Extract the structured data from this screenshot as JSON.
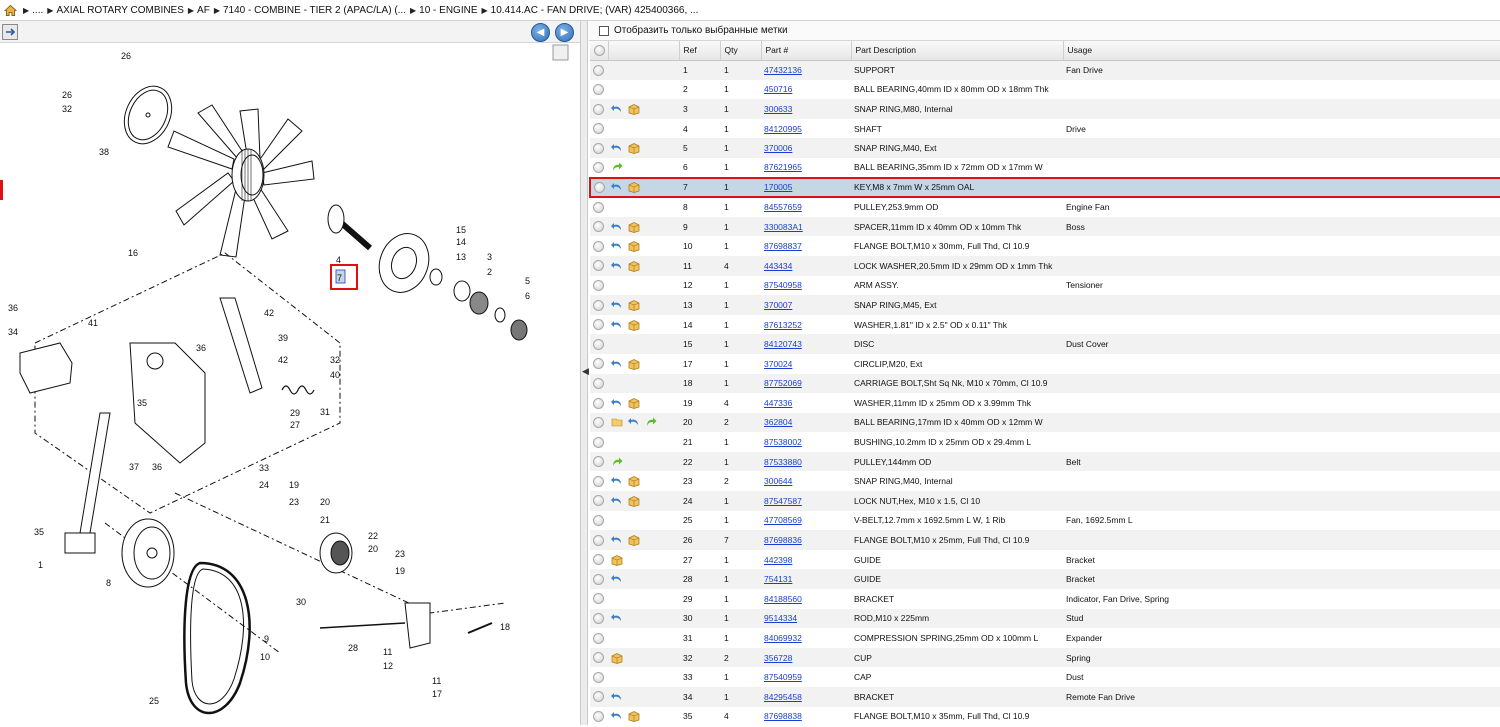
{
  "breadcrumb": {
    "items": [
      {
        "label": "...."
      },
      {
        "label": "AXIAL ROTARY COMBINES"
      },
      {
        "label": "AF"
      },
      {
        "label": "7140 - COMBINE - TIER 2 (APAC/LA) (..."
      },
      {
        "label": "10 - ENGINE"
      },
      {
        "label": "10.414.AC - FAN DRIVE; (VAR) 425400366, ..."
      }
    ]
  },
  "filter": {
    "label": "Отобразить только выбранные метки"
  },
  "table": {
    "headers": [
      "",
      "",
      "Ref",
      "Qty",
      "Part #",
      "Part Description",
      "Usage"
    ],
    "rows": [
      {
        "ref": "1",
        "qty": "1",
        "part": "47432136",
        "desc": "SUPPORT",
        "usage": "Fan Drive",
        "icons": []
      },
      {
        "ref": "2",
        "qty": "1",
        "part": "450716",
        "desc": "BALL BEARING,40mm ID x 80mm OD x 18mm Thk",
        "usage": "",
        "icons": []
      },
      {
        "ref": "3",
        "qty": "1",
        "part": "300633",
        "desc": "SNAP RING,M80, Internal",
        "usage": "",
        "icons": [
          "return-icon",
          "box-icon"
        ]
      },
      {
        "ref": "4",
        "qty": "1",
        "part": "84120995",
        "desc": "SHAFT",
        "usage": "Drive",
        "icons": []
      },
      {
        "ref": "5",
        "qty": "1",
        "part": "370006",
        "desc": "SNAP RING,M40, Ext",
        "usage": "",
        "icons": [
          "return-icon",
          "box-icon"
        ]
      },
      {
        "ref": "6",
        "qty": "1",
        "part": "87621965",
        "desc": "BALL BEARING,35mm ID x 72mm OD x 17mm W",
        "usage": "",
        "icons": [
          "forward-icon"
        ]
      },
      {
        "ref": "7",
        "qty": "1",
        "part": "170005",
        "desc": "KEY,M8 x 7mm W x 25mm OAL",
        "usage": "",
        "icons": [
          "return-icon",
          "box-icon"
        ],
        "selected": true
      },
      {
        "ref": "8",
        "qty": "1",
        "part": "84557659",
        "desc": "PULLEY,253.9mm OD",
        "usage": "Engine Fan",
        "icons": []
      },
      {
        "ref": "9",
        "qty": "1",
        "part": "330083A1",
        "desc": "SPACER,11mm ID x 40mm OD x 10mm Thk",
        "usage": "Boss",
        "icons": [
          "return-icon",
          "box-icon"
        ]
      },
      {
        "ref": "10",
        "qty": "1",
        "part": "87698837",
        "desc": "FLANGE BOLT,M10 x 30mm, Full Thd, Cl 10.9",
        "usage": "",
        "icons": [
          "return-icon",
          "box-icon"
        ]
      },
      {
        "ref": "11",
        "qty": "4",
        "part": "443434",
        "desc": "LOCK WASHER,20.5mm ID x 29mm OD x 1mm Thk",
        "usage": "",
        "icons": [
          "return-icon",
          "box-icon"
        ]
      },
      {
        "ref": "12",
        "qty": "1",
        "part": "87540958",
        "desc": "ARM ASSY.",
        "usage": "Tensioner",
        "icons": []
      },
      {
        "ref": "13",
        "qty": "1",
        "part": "370007",
        "desc": "SNAP RING,M45, Ext",
        "usage": "",
        "icons": [
          "return-icon",
          "box-icon"
        ]
      },
      {
        "ref": "14",
        "qty": "1",
        "part": "87613252",
        "desc": "WASHER,1.81\" ID x 2.5\" OD x 0.11\" Thk",
        "usage": "",
        "icons": [
          "return-icon",
          "box-icon"
        ]
      },
      {
        "ref": "15",
        "qty": "1",
        "part": "84120743",
        "desc": "DISC",
        "usage": "Dust Cover",
        "icons": []
      },
      {
        "ref": "17",
        "qty": "1",
        "part": "370024",
        "desc": "CIRCLIP,M20, Ext",
        "usage": "",
        "icons": [
          "return-icon",
          "box-icon"
        ]
      },
      {
        "ref": "18",
        "qty": "1",
        "part": "87752069",
        "desc": "CARRIAGE BOLT,Sht Sq Nk, M10 x 70mm, Cl 10.9",
        "usage": "",
        "icons": []
      },
      {
        "ref": "19",
        "qty": "4",
        "part": "447336",
        "desc": "WASHER,11mm ID x 25mm OD x 3.99mm Thk",
        "usage": "",
        "icons": [
          "return-icon",
          "box-icon"
        ]
      },
      {
        "ref": "20",
        "qty": "2",
        "part": "362804",
        "desc": "BALL BEARING,17mm ID x 40mm OD x 12mm W",
        "usage": "",
        "icons": [
          "folder-icon",
          "return-icon",
          "forward-icon"
        ]
      },
      {
        "ref": "21",
        "qty": "1",
        "part": "87538002",
        "desc": "BUSHING,10.2mm ID x 25mm OD x 29.4mm L",
        "usage": "",
        "icons": []
      },
      {
        "ref": "22",
        "qty": "1",
        "part": "87533880",
        "desc": "PULLEY,144mm OD",
        "usage": "Belt",
        "icons": [
          "forward-icon"
        ]
      },
      {
        "ref": "23",
        "qty": "2",
        "part": "300644",
        "desc": "SNAP RING,M40, Internal",
        "usage": "",
        "icons": [
          "return-icon",
          "box-icon"
        ]
      },
      {
        "ref": "24",
        "qty": "1",
        "part": "87547587",
        "desc": "LOCK NUT,Hex, M10 x 1.5, Cl 10",
        "usage": "",
        "icons": [
          "return-icon",
          "box-icon"
        ]
      },
      {
        "ref": "25",
        "qty": "1",
        "part": "47708569",
        "desc": "V-BELT,12.7mm x 1692.5mm L W, 1 Rib",
        "usage": "Fan, 1692.5mm L",
        "icons": []
      },
      {
        "ref": "26",
        "qty": "7",
        "part": "87698836",
        "desc": "FLANGE BOLT,M10 x 25mm, Full Thd, Cl 10.9",
        "usage": "",
        "icons": [
          "return-icon",
          "box-icon"
        ]
      },
      {
        "ref": "27",
        "qty": "1",
        "part": "442398",
        "desc": "GUIDE",
        "usage": "Bracket",
        "icons": [
          "box-icon"
        ]
      },
      {
        "ref": "28",
        "qty": "1",
        "part": "754131",
        "desc": "GUIDE",
        "usage": "Bracket",
        "icons": [
          "return-icon"
        ]
      },
      {
        "ref": "29",
        "qty": "1",
        "part": "84188560",
        "desc": "BRACKET",
        "usage": "Indicator, Fan Drive, Spring",
        "icons": []
      },
      {
        "ref": "30",
        "qty": "1",
        "part": "9514334",
        "desc": "ROD,M10 x 225mm",
        "usage": "Stud",
        "icons": [
          "return-icon"
        ]
      },
      {
        "ref": "31",
        "qty": "1",
        "part": "84069932",
        "desc": "COMPRESSION SPRING,25mm OD x 100mm L",
        "usage": "Expander",
        "icons": []
      },
      {
        "ref": "32",
        "qty": "2",
        "part": "356728",
        "desc": "CUP",
        "usage": "Spring",
        "icons": [
          "box-icon"
        ]
      },
      {
        "ref": "33",
        "qty": "1",
        "part": "87540959",
        "desc": "CAP",
        "usage": "Dust",
        "icons": []
      },
      {
        "ref": "34",
        "qty": "1",
        "part": "84295458",
        "desc": "BRACKET",
        "usage": "Remote Fan Drive",
        "icons": [
          "return-icon"
        ]
      },
      {
        "ref": "35",
        "qty": "4",
        "part": "87698838",
        "desc": "FLANGE BOLT,M10 x 35mm, Full Thd, Cl 10.9",
        "usage": "",
        "icons": [
          "return-icon",
          "box-icon"
        ]
      }
    ]
  },
  "diagram": {
    "callouts": [
      "26",
      "26",
      "32",
      "38",
      "16",
      "4",
      "7",
      "15",
      "14",
      "13",
      "3",
      "2",
      "5",
      "6",
      "36",
      "41",
      "42",
      "34",
      "39",
      "36",
      "42",
      "32",
      "40",
      "35",
      "29",
      "31",
      "27",
      "37",
      "36",
      "33",
      "24",
      "19",
      "23",
      "20",
      "21",
      "22",
      "20",
      "23",
      "19",
      "35",
      "1",
      "8",
      "30",
      "18",
      "9",
      "10",
      "28",
      "11",
      "12",
      "11",
      "17",
      "25"
    ]
  },
  "colors": {
    "selection_border": "#d11111",
    "selection_fill": "#c5d6e5",
    "link": "#1a3fd0"
  }
}
